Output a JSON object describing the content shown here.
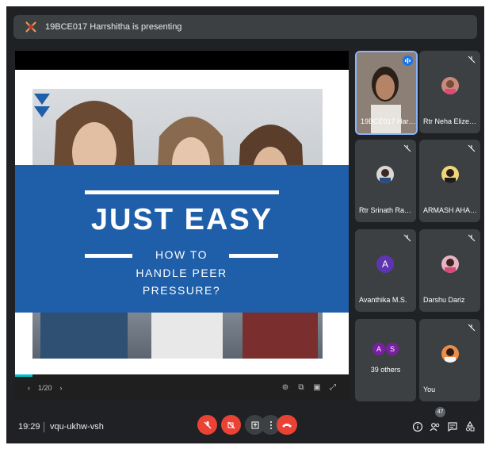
{
  "top": {
    "presenting_text": "19BCE017 Harrshitha is presenting"
  },
  "slide": {
    "title": "JUST EASY",
    "subtitle_line1": "HOW TO",
    "subtitle_line2": "HANDLE PEER",
    "subtitle_line3": "PRESSURE?",
    "page": "1/20"
  },
  "tiles": [
    {
      "name": "19BCE017 Harrshi..."
    },
    {
      "name": "Rtr Neha Elizebeth ..."
    },
    {
      "name": "Rtr Srinath Rangar..."
    },
    {
      "name": "ARMASH AHAMED"
    },
    {
      "name": "Avanthika M.S.",
      "initial": "A"
    },
    {
      "name": "Darshu Dariz"
    },
    {
      "name": "39 others",
      "initials": [
        "A",
        "S"
      ]
    },
    {
      "name": "You"
    }
  ],
  "bottom": {
    "time": "19:29",
    "meeting_code": "vqu-ukhw-vsh",
    "participants_count": "47"
  },
  "colors": {
    "meet_bg": "#202124",
    "tile": "#3c4043",
    "slide_blue": "#1f5ea8",
    "red": "#ea4335",
    "active_border": "#8ab4f8"
  }
}
